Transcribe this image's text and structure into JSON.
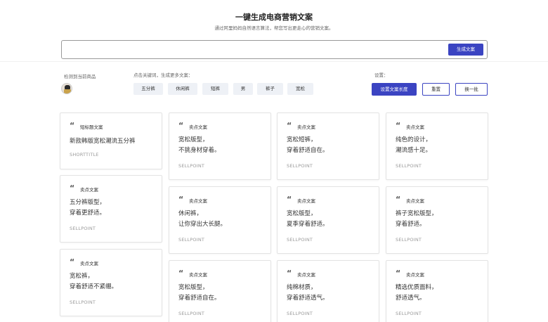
{
  "header": {
    "title": "一键生成电商营销文案",
    "subtitle": "通过阿里妈妈自然语言算法，帮您写出更走心的营销文案。"
  },
  "generator": {
    "input_value": "",
    "button_label": "生成文案"
  },
  "detect": {
    "label": "检测到当前商品"
  },
  "keywords": {
    "label": "点击关键词，生成更多文案：",
    "tags": [
      "五分裤",
      "休闲裤",
      "短裤",
      "男",
      "裤子",
      "宽松"
    ]
  },
  "settings": {
    "label": "设置：",
    "length_button": "设置文案长度",
    "reset_button": "重置",
    "refresh_button": "换一批"
  },
  "cards": [
    {
      "type": "短标题文案",
      "lines": [
        "新款韩版宽松潮流五分裤"
      ],
      "tag": "SHORTTITLE"
    },
    {
      "type": "卖点文案",
      "lines": [
        "五分裤版型，",
        "穿着更舒适。"
      ],
      "tag": "SELLPOINT"
    },
    {
      "type": "卖点文案",
      "lines": [
        "宽松裤，",
        "穿着舒适不紧绷。"
      ],
      "tag": "SELLPOINT"
    },
    {
      "type": "卖点文案",
      "lines": [
        "宽松版型，",
        "不挑身材穿着。"
      ],
      "tag": "SELLPOINT"
    },
    {
      "type": "卖点文案",
      "lines": [
        "休闲裤，",
        "让你穿出大长腿。"
      ],
      "tag": "SELLPOINT"
    },
    {
      "type": "卖点文案",
      "lines": [
        "宽松版型，",
        "穿着舒适自在。"
      ],
      "tag": "SELLPOINT"
    },
    {
      "type": "卖点文案",
      "lines": [
        "宽松短裤，",
        "穿着舒适自在。"
      ],
      "tag": "SELLPOINT"
    },
    {
      "type": "卖点文案",
      "lines": [
        "宽松版型，",
        "夏季穿着舒适。"
      ],
      "tag": "SELLPOINT"
    },
    {
      "type": "卖点文案",
      "lines": [
        "纯棉材质，",
        "穿着舒适透气。"
      ],
      "tag": "SELLPOINT"
    },
    {
      "type": "卖点文案",
      "lines": [
        "纯色的设计，",
        "潮流感十足。"
      ],
      "tag": "SELLPOINT"
    },
    {
      "type": "卖点文案",
      "lines": [
        "裤子宽松版型，",
        "穿着舒适。"
      ],
      "tag": "SELLPOINT"
    },
    {
      "type": "卖点文案",
      "lines": [
        "精选优质面料，",
        "舒适透气。"
      ],
      "tag": "SELLPOINT"
    }
  ],
  "colors": {
    "accent": "#3b44c2",
    "tag_bg": "#eef1f6",
    "card_border": "#e3e3e3"
  },
  "icons": {
    "quote": "quote-icon"
  }
}
